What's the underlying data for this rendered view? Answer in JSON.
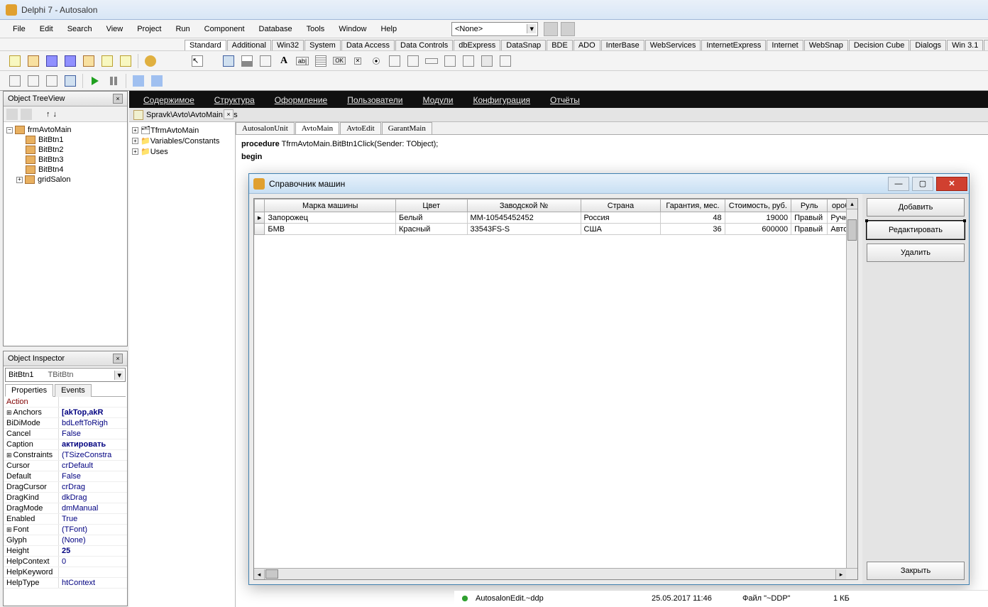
{
  "title": "Delphi 7 - Autosalon",
  "menu": [
    "File",
    "Edit",
    "Search",
    "View",
    "Project",
    "Run",
    "Component",
    "Database",
    "Tools",
    "Window",
    "Help"
  ],
  "combo_value": "<None>",
  "palette_tabs": [
    "Standard",
    "Additional",
    "Win32",
    "System",
    "Data Access",
    "Data Controls",
    "dbExpress",
    "DataSnap",
    "BDE",
    "ADO",
    "InterBase",
    "WebServices",
    "InternetExpress",
    "Internet",
    "WebSnap",
    "Decision Cube",
    "Dialogs",
    "Win 3.1",
    "Samples",
    "Ac"
  ],
  "dark_menu": [
    "Содержимое",
    "Структура",
    "Оформление",
    "Пользователи",
    "Модули",
    "Конфигурация",
    "Отчёты"
  ],
  "treeview": {
    "title": "Object TreeView",
    "root": "frmAvtoMain",
    "children": [
      "BitBtn1",
      "BitBtn2",
      "BitBtn3",
      "BitBtn4",
      "gridSalon"
    ]
  },
  "inspector": {
    "title": "Object Inspector",
    "component": "BitBtn1",
    "component_type": "TBitBtn",
    "tabs": [
      "Properties",
      "Events"
    ],
    "props": [
      {
        "n": "Action",
        "v": "",
        "hl": true
      },
      {
        "n": "Anchors",
        "v": "[akTop,akR",
        "plus": true,
        "bold": true
      },
      {
        "n": "BiDiMode",
        "v": "bdLeftToRigh"
      },
      {
        "n": "Cancel",
        "v": "False"
      },
      {
        "n": "Caption",
        "v": "актировать",
        "bold": true
      },
      {
        "n": "Constraints",
        "v": "(TSizeConstra",
        "plus": true
      },
      {
        "n": "Cursor",
        "v": "crDefault"
      },
      {
        "n": "Default",
        "v": "False"
      },
      {
        "n": "DragCursor",
        "v": "crDrag"
      },
      {
        "n": "DragKind",
        "v": "dkDrag"
      },
      {
        "n": "DragMode",
        "v": "dmManual"
      },
      {
        "n": "Enabled",
        "v": "True"
      },
      {
        "n": "Font",
        "v": "(TFont)",
        "plus": true
      },
      {
        "n": "Glyph",
        "v": "(None)"
      },
      {
        "n": "Height",
        "v": "25",
        "bold": true
      },
      {
        "n": "HelpContext",
        "v": "0"
      },
      {
        "n": "HelpKeyword",
        "v": ""
      },
      {
        "n": "HelpType",
        "v": "htContext"
      }
    ]
  },
  "editor": {
    "path": "Spravk\\Avto\\AvtoMain.pas",
    "struct": [
      "TfrmAvtoMain",
      "Variables/Constants",
      "Uses"
    ],
    "tabs": [
      "AutosalonUnit",
      "AvtoMain",
      "AvtoEdit",
      "GarantMain"
    ],
    "active_tab": "AvtoMain",
    "code_line1": "procedure TfrmAvtoMain.BitBtn1Click(Sender: TObject);",
    "code_line2": "begin"
  },
  "child": {
    "title": "Справочник машин",
    "buttons": [
      "Добавить",
      "Редактировать",
      "Удалить"
    ],
    "close_btn": "Закрыть",
    "selected_btn": 1,
    "grid": {
      "headers": [
        "Марка машины",
        "Цвет",
        "Заводской №",
        "Страна",
        "Гарантия, мес.",
        "Стоимость, руб.",
        "Руль",
        "оробк"
      ],
      "rows": [
        {
          "marker": "▸",
          "cells": [
            "Запорожец",
            "Белый",
            "ММ-10545452452",
            "Россия",
            "48",
            "19000",
            "Правый",
            "Ручн"
          ]
        },
        {
          "marker": "",
          "cells": [
            "БМВ",
            "Красный",
            "33543FS-S",
            "США",
            "36",
            "600000",
            "Правый",
            "Автом"
          ]
        }
      ]
    }
  },
  "file_row": {
    "name": "AutosalonEdit.~ddp",
    "date": "25.05.2017 11:46",
    "type": "Файл \"~DDP\"",
    "size": "1 КБ"
  }
}
